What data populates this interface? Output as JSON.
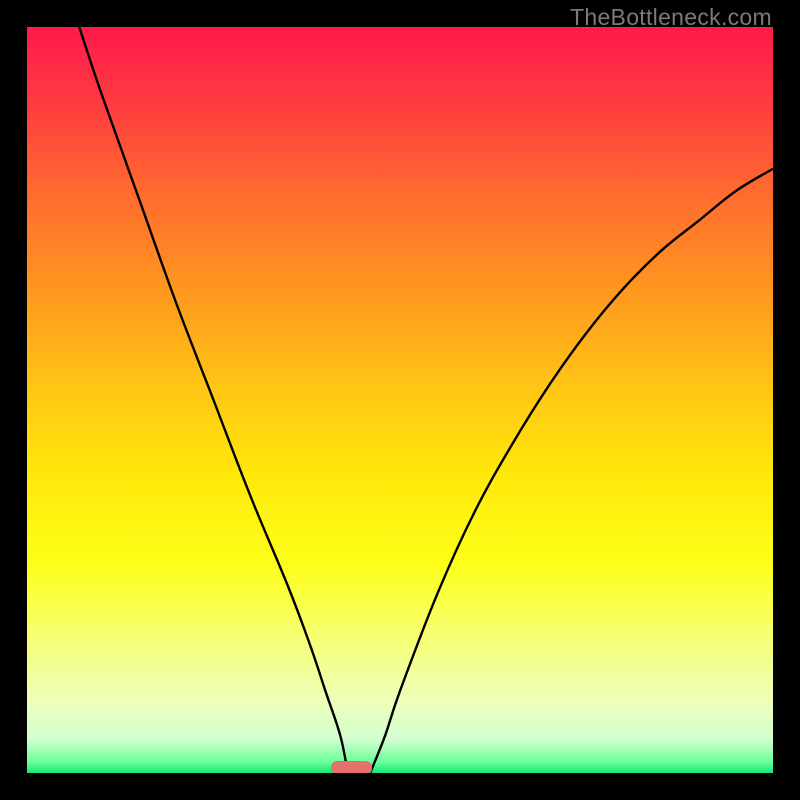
{
  "watermark": "TheBottleneck.com",
  "chart_data": {
    "type": "line",
    "title": "",
    "xlabel": "",
    "ylabel": "",
    "xlim": [
      0,
      100
    ],
    "ylim": [
      0,
      100
    ],
    "notes": "Two curves forming a V-shape over a vertical rainbow gradient (red at top through orange, yellow, pale yellow, to green at bottom). A small rounded red marker sits at the valley bottom near x≈43. No axis ticks or numeric labels are visible.",
    "series": [
      {
        "name": "left-curve",
        "x": [
          7,
          10,
          15,
          20,
          25,
          30,
          35,
          38,
          40,
          42,
          43
        ],
        "values": [
          100,
          91,
          77,
          63,
          50,
          37,
          25,
          17,
          11,
          5,
          0
        ]
      },
      {
        "name": "right-curve",
        "x": [
          46,
          48,
          50,
          55,
          60,
          65,
          70,
          75,
          80,
          85,
          90,
          95,
          100
        ],
        "values": [
          0,
          5,
          11,
          24,
          35,
          44,
          52,
          59,
          65,
          70,
          74,
          78,
          81
        ]
      }
    ],
    "marker": {
      "x": 43.5,
      "y": 0.7,
      "w": 5.5,
      "h": 1.8,
      "color": "#e2726b"
    },
    "gradient_stops": [
      {
        "offset": 0.0,
        "color": "#ff1a4b"
      },
      {
        "offset": 0.1,
        "color": "#ff3a41"
      },
      {
        "offset": 0.22,
        "color": "#ff6a2f"
      },
      {
        "offset": 0.35,
        "color": "#ff9620"
      },
      {
        "offset": 0.48,
        "color": "#ffc414"
      },
      {
        "offset": 0.6,
        "color": "#ffe80a"
      },
      {
        "offset": 0.72,
        "color": "#fdff19"
      },
      {
        "offset": 0.82,
        "color": "#f6ff75"
      },
      {
        "offset": 0.9,
        "color": "#eeffb8"
      },
      {
        "offset": 0.955,
        "color": "#d3ffd0"
      },
      {
        "offset": 0.985,
        "color": "#6bff9a"
      },
      {
        "offset": 1.0,
        "color": "#14e874"
      }
    ]
  }
}
